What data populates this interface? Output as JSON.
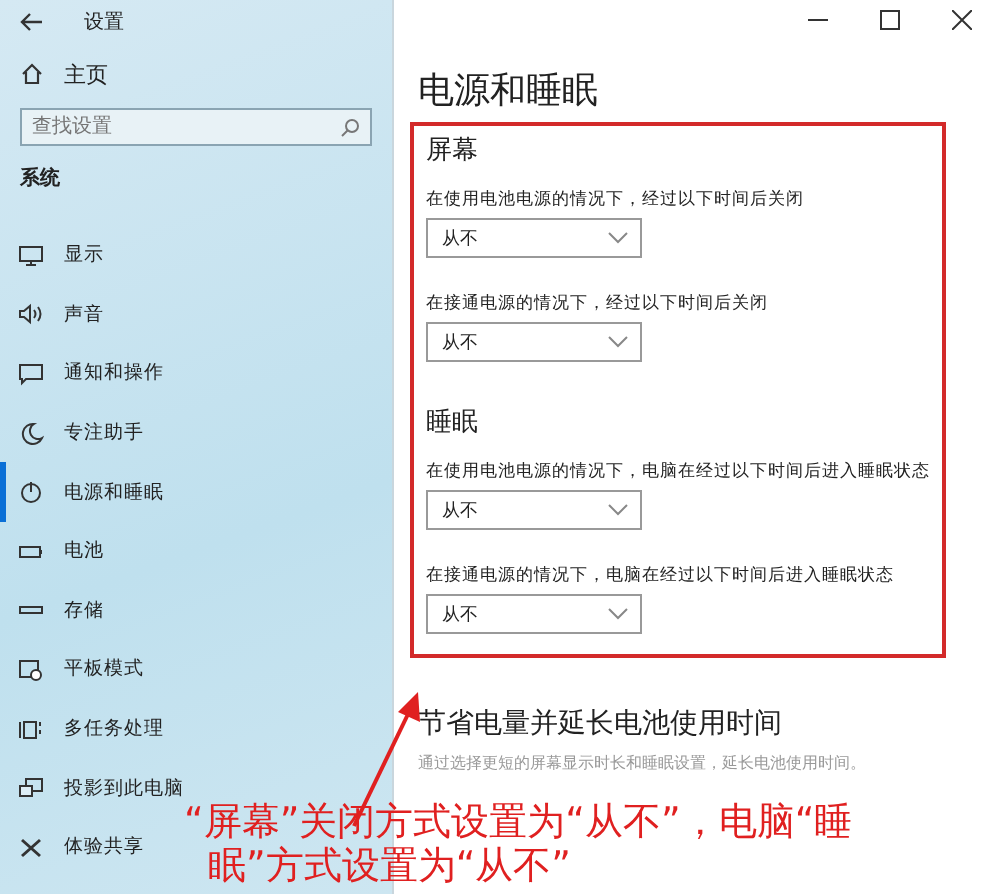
{
  "window": {
    "title": "设置"
  },
  "sidebar": {
    "home": "主页",
    "search": {
      "placeholder": "查找设置"
    },
    "section": "系统",
    "items": [
      {
        "label": "显示",
        "selected": false
      },
      {
        "label": "声音",
        "selected": false
      },
      {
        "label": "通知和操作",
        "selected": false
      },
      {
        "label": "专注助手",
        "selected": false
      },
      {
        "label": "电源和睡眠",
        "selected": true
      },
      {
        "label": "电池",
        "selected": false
      },
      {
        "label": "存储",
        "selected": false
      },
      {
        "label": "平板模式",
        "selected": false
      },
      {
        "label": "多任务处理",
        "selected": false
      },
      {
        "label": "投影到此电脑",
        "selected": false
      },
      {
        "label": "体验共享",
        "selected": false
      }
    ]
  },
  "page": {
    "title": "电源和睡眠",
    "groups": [
      {
        "heading": "屏幕",
        "settings": [
          {
            "label": "在使用电池电源的情况下，经过以下时间后关闭",
            "value": "从不"
          },
          {
            "label": "在接通电源的情况下，经过以下时间后关闭",
            "value": "从不"
          }
        ]
      },
      {
        "heading": "睡眠",
        "settings": [
          {
            "label": "在使用电池电源的情况下，电脑在经过以下时间后进入睡眠状态",
            "value": "从不"
          },
          {
            "label": "在接通电源的情况下，电脑在经过以下时间后进入睡眠状态",
            "value": "从不"
          }
        ]
      }
    ],
    "tip": {
      "heading": "节省电量并延长电池使用时间",
      "text": "通过选择更短的屏幕显示时长和睡眠设置，延长电池使用时间。"
    }
  },
  "annotation": {
    "lines": [
      "“屏幕”关闭方式设置为“从不”，电脑“睡",
      "眠”方式设置为“从不”"
    ]
  }
}
